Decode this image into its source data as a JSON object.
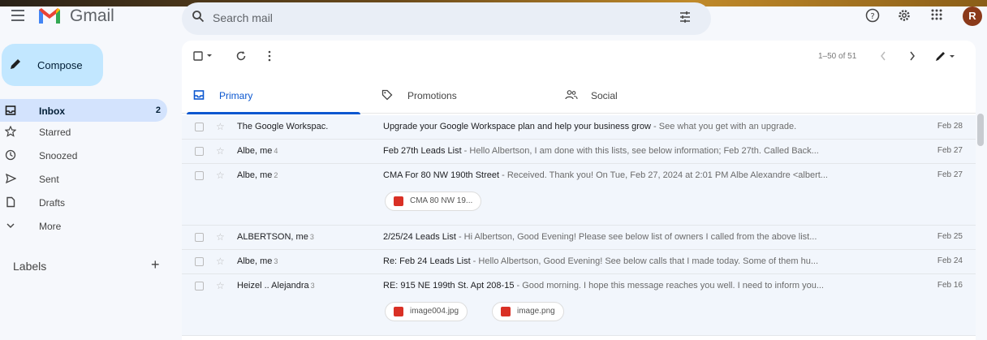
{
  "app": {
    "name": "Gmail"
  },
  "search": {
    "placeholder": "Search mail"
  },
  "account": {
    "initial": "R"
  },
  "sidebar": {
    "compose_label": "Compose",
    "items": [
      {
        "label": "Inbox",
        "count": "2",
        "icon": "inbox-icon",
        "active": true
      },
      {
        "label": "Starred",
        "count": "",
        "icon": "star-icon"
      },
      {
        "label": "Snoozed",
        "count": "",
        "icon": "clock-icon"
      },
      {
        "label": "Sent",
        "count": "",
        "icon": "send-icon"
      },
      {
        "label": "Drafts",
        "count": "",
        "icon": "draft-icon"
      },
      {
        "label": "More",
        "count": "",
        "icon": "chevron-down-icon"
      }
    ],
    "labels_title": "Labels"
  },
  "toolbar": {
    "page_info": "1–50 of 51"
  },
  "tabs": [
    {
      "label": "Primary",
      "icon": "inbox-icon",
      "active": true
    },
    {
      "label": "Promotions",
      "icon": "tag-icon"
    },
    {
      "label": "Social",
      "icon": "people-icon"
    }
  ],
  "emails": [
    {
      "sender": "The Google Workspac.",
      "count": "",
      "subject": "Upgrade your Google Workspace plan and help your business grow",
      "preview": " - See what you get with an upgrade.",
      "date": "Feb 28",
      "attachments": []
    },
    {
      "sender": "Albe, me",
      "count": "4",
      "subject": "Feb 27th Leads List",
      "preview": " - Hello Albertson, I am done with this lists, see below information; Feb 27th. Called Back...",
      "date": "Feb 27",
      "attachments": []
    },
    {
      "sender": "Albe, me",
      "count": "2",
      "subject": "CMA For 80 NW 190th Street",
      "preview": " - Received. Thank you! On Tue, Feb 27, 2024 at 2:01 PM Albe Alexandre <albert...",
      "date": "Feb 27",
      "attachments": [
        "CMA 80 NW 19..."
      ]
    },
    {
      "sender": "ALBERTSON, me",
      "count": "3",
      "subject": "2/25/24 Leads List",
      "preview": " - Hi Albertson, Good Evening! Please see below list of owners I called from the above list...",
      "date": "Feb 25",
      "attachments": []
    },
    {
      "sender": "Albe, me",
      "count": "3",
      "subject": "Re: Feb 24 Leads List",
      "preview": " - Hello Albertson, Good Evening! See below calls that I made today. Some of them hu...",
      "date": "Feb 24",
      "attachments": []
    },
    {
      "sender": "Heizel .. Alejandra",
      "count": "3",
      "subject": "RE: 915 NE 199th St. Apt 208-15",
      "preview": " - Good morning. I hope this message reaches you well. I need to inform you...",
      "date": "Feb 16",
      "attachments": [
        "image004.jpg",
        "image.png"
      ]
    }
  ]
}
